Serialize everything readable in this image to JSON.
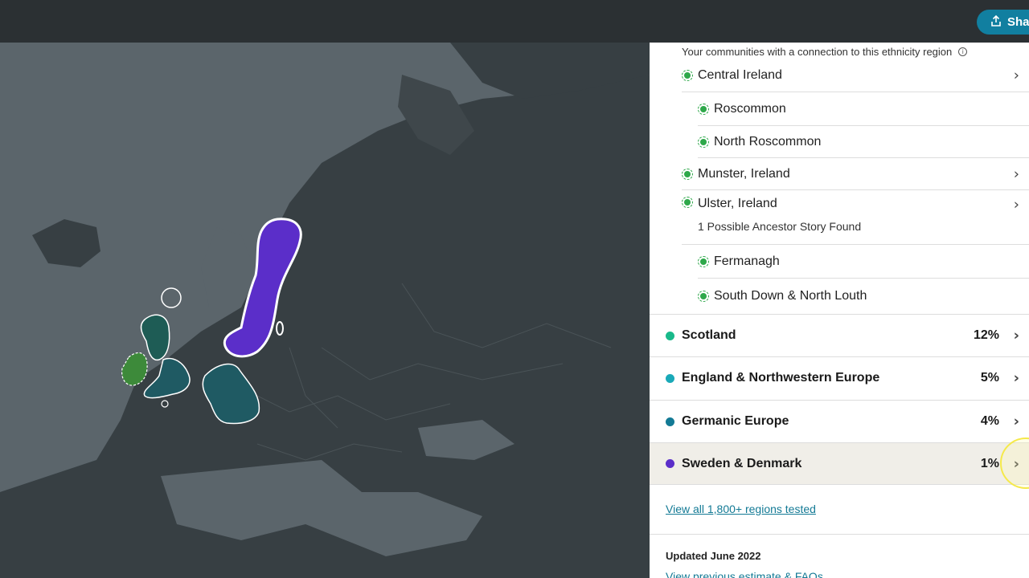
{
  "header": {
    "share_label": "Sha"
  },
  "communities": {
    "header": "Your communities with a connection to this ethnicity region",
    "items": [
      {
        "label": "Central Ireland"
      },
      {
        "label": "Roscommon"
      },
      {
        "label": "North Roscommon"
      },
      {
        "label": "Munster, Ireland"
      },
      {
        "label": "Ulster, Ireland"
      },
      {
        "label": "Fermanagh"
      },
      {
        "label": "South Down & North Louth"
      }
    ],
    "ancestor_note": "1 Possible Ancestor Story Found"
  },
  "ethnicity": [
    {
      "name": "Scotland",
      "pct": "12%",
      "color": "#19b98a"
    },
    {
      "name": "England & Northwestern Europe",
      "pct": "5%",
      "color": "#1aa9b8"
    },
    {
      "name": "Germanic Europe",
      "pct": "4%",
      "color": "#137a95"
    },
    {
      "name": "Sweden & Denmark",
      "pct": "1%",
      "color": "#5b2ec9"
    }
  ],
  "links": {
    "view_all": "View all 1,800+ regions tested",
    "updated": "Updated June 2022",
    "previous": "View previous estimate & FAQs"
  },
  "icons": {
    "share": "share-icon",
    "chevron": "chevron-right-icon",
    "info": "info-icon"
  }
}
